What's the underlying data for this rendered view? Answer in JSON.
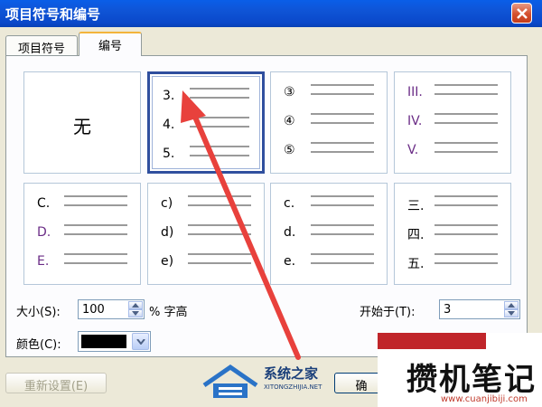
{
  "window": {
    "title": "项目符号和编号"
  },
  "tabs": [
    {
      "label": "项目符号",
      "active": false
    },
    {
      "label": "编号",
      "active": true
    }
  ],
  "gallery": {
    "none_label": "无",
    "selected_index": 1,
    "cells": [
      {
        "labels": []
      },
      {
        "labels": [
          "3.",
          "4.",
          "5."
        ]
      },
      {
        "labels": [
          "③",
          "④",
          "⑤"
        ]
      },
      {
        "labels": [
          "III.",
          "IV.",
          "V."
        ]
      },
      {
        "labels": [
          "C.",
          "D.",
          "E."
        ]
      },
      {
        "labels": [
          "c)",
          "d)",
          "e)"
        ]
      },
      {
        "labels": [
          "c.",
          "d.",
          "e."
        ]
      },
      {
        "labels": [
          "三.",
          "四.",
          "五."
        ]
      }
    ]
  },
  "size": {
    "label": "大小(S):",
    "value": "100",
    "unit": "% 字高"
  },
  "color": {
    "label": "颜色(C):",
    "value": "#000000"
  },
  "start_at": {
    "label": "开始于(T):",
    "value": "3"
  },
  "buttons": {
    "reset": "重新设置(E)",
    "ok": "确"
  },
  "watermarks": {
    "left_title": "系统之家",
    "left_sub": "XITONGZHIJIA.NET",
    "right_title": "攒机笔记",
    "right_sub": "www.cuanjibiji.com"
  },
  "colors": {
    "titlebar": "#0a5ee8",
    "selection": "#2f4e9e",
    "annotation_arrow": "#e8413c"
  }
}
